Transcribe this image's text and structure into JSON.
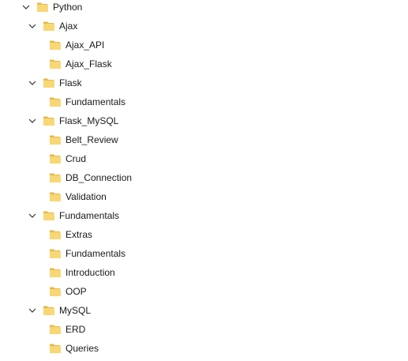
{
  "colors": {
    "folder_fill": "#F8D775",
    "folder_back": "#E8B84A",
    "chevron": "#333333",
    "text": "#1a1a1a"
  },
  "tree": {
    "root": {
      "label": "Python",
      "expanded": true,
      "icon": "folder-icon"
    },
    "groups": [
      {
        "label": "Ajax",
        "expanded": true,
        "children": [
          "Ajax_API",
          "Ajax_Flask"
        ]
      },
      {
        "label": "Flask",
        "expanded": true,
        "children": [
          "Fundamentals"
        ]
      },
      {
        "label": "Flask_MySQL",
        "expanded": true,
        "children": [
          "Belt_Review",
          "Crud",
          "DB_Connection",
          "Validation"
        ]
      },
      {
        "label": "Fundamentals",
        "expanded": true,
        "children": [
          "Extras",
          "Fundamentals",
          "Introduction",
          "OOP"
        ]
      },
      {
        "label": "MySQL",
        "expanded": true,
        "children": [
          "ERD",
          "Queries"
        ]
      }
    ]
  }
}
